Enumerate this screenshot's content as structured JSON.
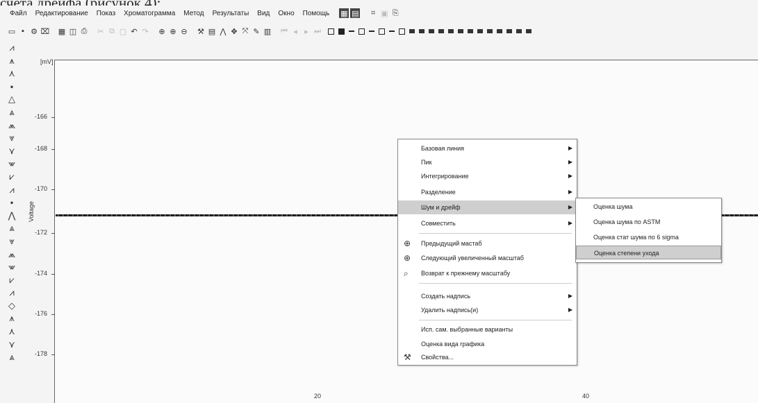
{
  "caption": "счета дрейфа (рисунок 4);",
  "menubar": {
    "items": [
      "Файл",
      "Редактирование",
      "Показ",
      "Хроматограмма",
      "Метод",
      "Результаты",
      "Вид",
      "Окно",
      "Помощь"
    ]
  },
  "plot": {
    "unit_label": "[mV]",
    "y_axis_title": "Voltage",
    "y_ticks": [
      "-166",
      "-168",
      "-170",
      "-172",
      "-174",
      "-176",
      "-178"
    ],
    "x_ticks": [
      "20",
      "40"
    ]
  },
  "context_menu": {
    "items": [
      {
        "label": "Базовая линия",
        "submenu": true
      },
      {
        "label": "Пик",
        "submenu": true
      },
      {
        "label": "Интегрирование",
        "submenu": true
      },
      {
        "label": "Разделение",
        "submenu": true
      },
      {
        "label": "Шум и дрейф",
        "submenu": true,
        "highlighted": true
      },
      {
        "label": "Совместить",
        "submenu": true
      },
      {
        "label": "Предыдущий мастаб",
        "icon": "zoom-in-icon"
      },
      {
        "label": "Следующий увеличенный масштаб",
        "icon": "zoom-in-icon"
      },
      {
        "label": "Возврат к прежнему масштабу",
        "icon": "zoom-reset-icon"
      },
      {
        "label": "Создать надпись",
        "submenu": true
      },
      {
        "label": "Удалить надпись(и)",
        "submenu": true
      },
      {
        "label": "Исп. сам. выбранные варианты"
      },
      {
        "label": "Оценка вида графика"
      },
      {
        "label": "Свойства...",
        "icon": "wrench-icon"
      }
    ]
  },
  "submenu": {
    "items": [
      {
        "label": "Оценка шума"
      },
      {
        "label": "Оценка шума по ASTM"
      },
      {
        "label": "Оценка стат шума по 6 sigma"
      },
      {
        "label": "Оценка степени ухода",
        "highlighted": true
      }
    ]
  }
}
